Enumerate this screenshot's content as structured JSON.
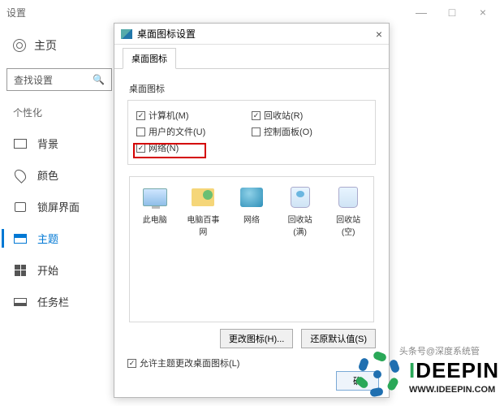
{
  "window": {
    "title": "设置",
    "controls": {
      "min": "—",
      "max": "□",
      "close": "×"
    }
  },
  "sidebar": {
    "home": "主页",
    "search_placeholder": "查找设置",
    "section": "个性化",
    "items": [
      {
        "label": "背景"
      },
      {
        "label": "颜色"
      },
      {
        "label": "锁屏界面"
      },
      {
        "label": "主题"
      },
      {
        "label": "开始"
      },
      {
        "label": "任务栏"
      }
    ]
  },
  "dialog": {
    "title": "桌面图标设置",
    "tab": "桌面图标",
    "group_label": "桌面图标",
    "checks": {
      "computer": {
        "label": "计算机(M)",
        "checked": true
      },
      "recycle": {
        "label": "回收站(R)",
        "checked": true
      },
      "userfiles": {
        "label": "用户的文件(U)",
        "checked": false
      },
      "control": {
        "label": "控制面板(O)",
        "checked": false
      },
      "network": {
        "label": "网络(N)",
        "checked": true
      }
    },
    "icons": [
      {
        "label": "此电脑"
      },
      {
        "label": "电脑百事网"
      },
      {
        "label": "网络"
      },
      {
        "label": "回收站(满)"
      },
      {
        "label": "回收站(空)"
      }
    ],
    "buttons": {
      "change": "更改图标(H)...",
      "restore": "还原默认值(S)"
    },
    "allow_themes": {
      "label": "允许主题更改桌面图标(L)",
      "checked": true
    },
    "footer": {
      "ok": "确"
    }
  },
  "watermark": {
    "brand_prefix": "I",
    "brand_rest": "DEEPIN",
    "sub": "WWW.IDEEPIN.COM",
    "note": "头条号@深度系统管"
  }
}
